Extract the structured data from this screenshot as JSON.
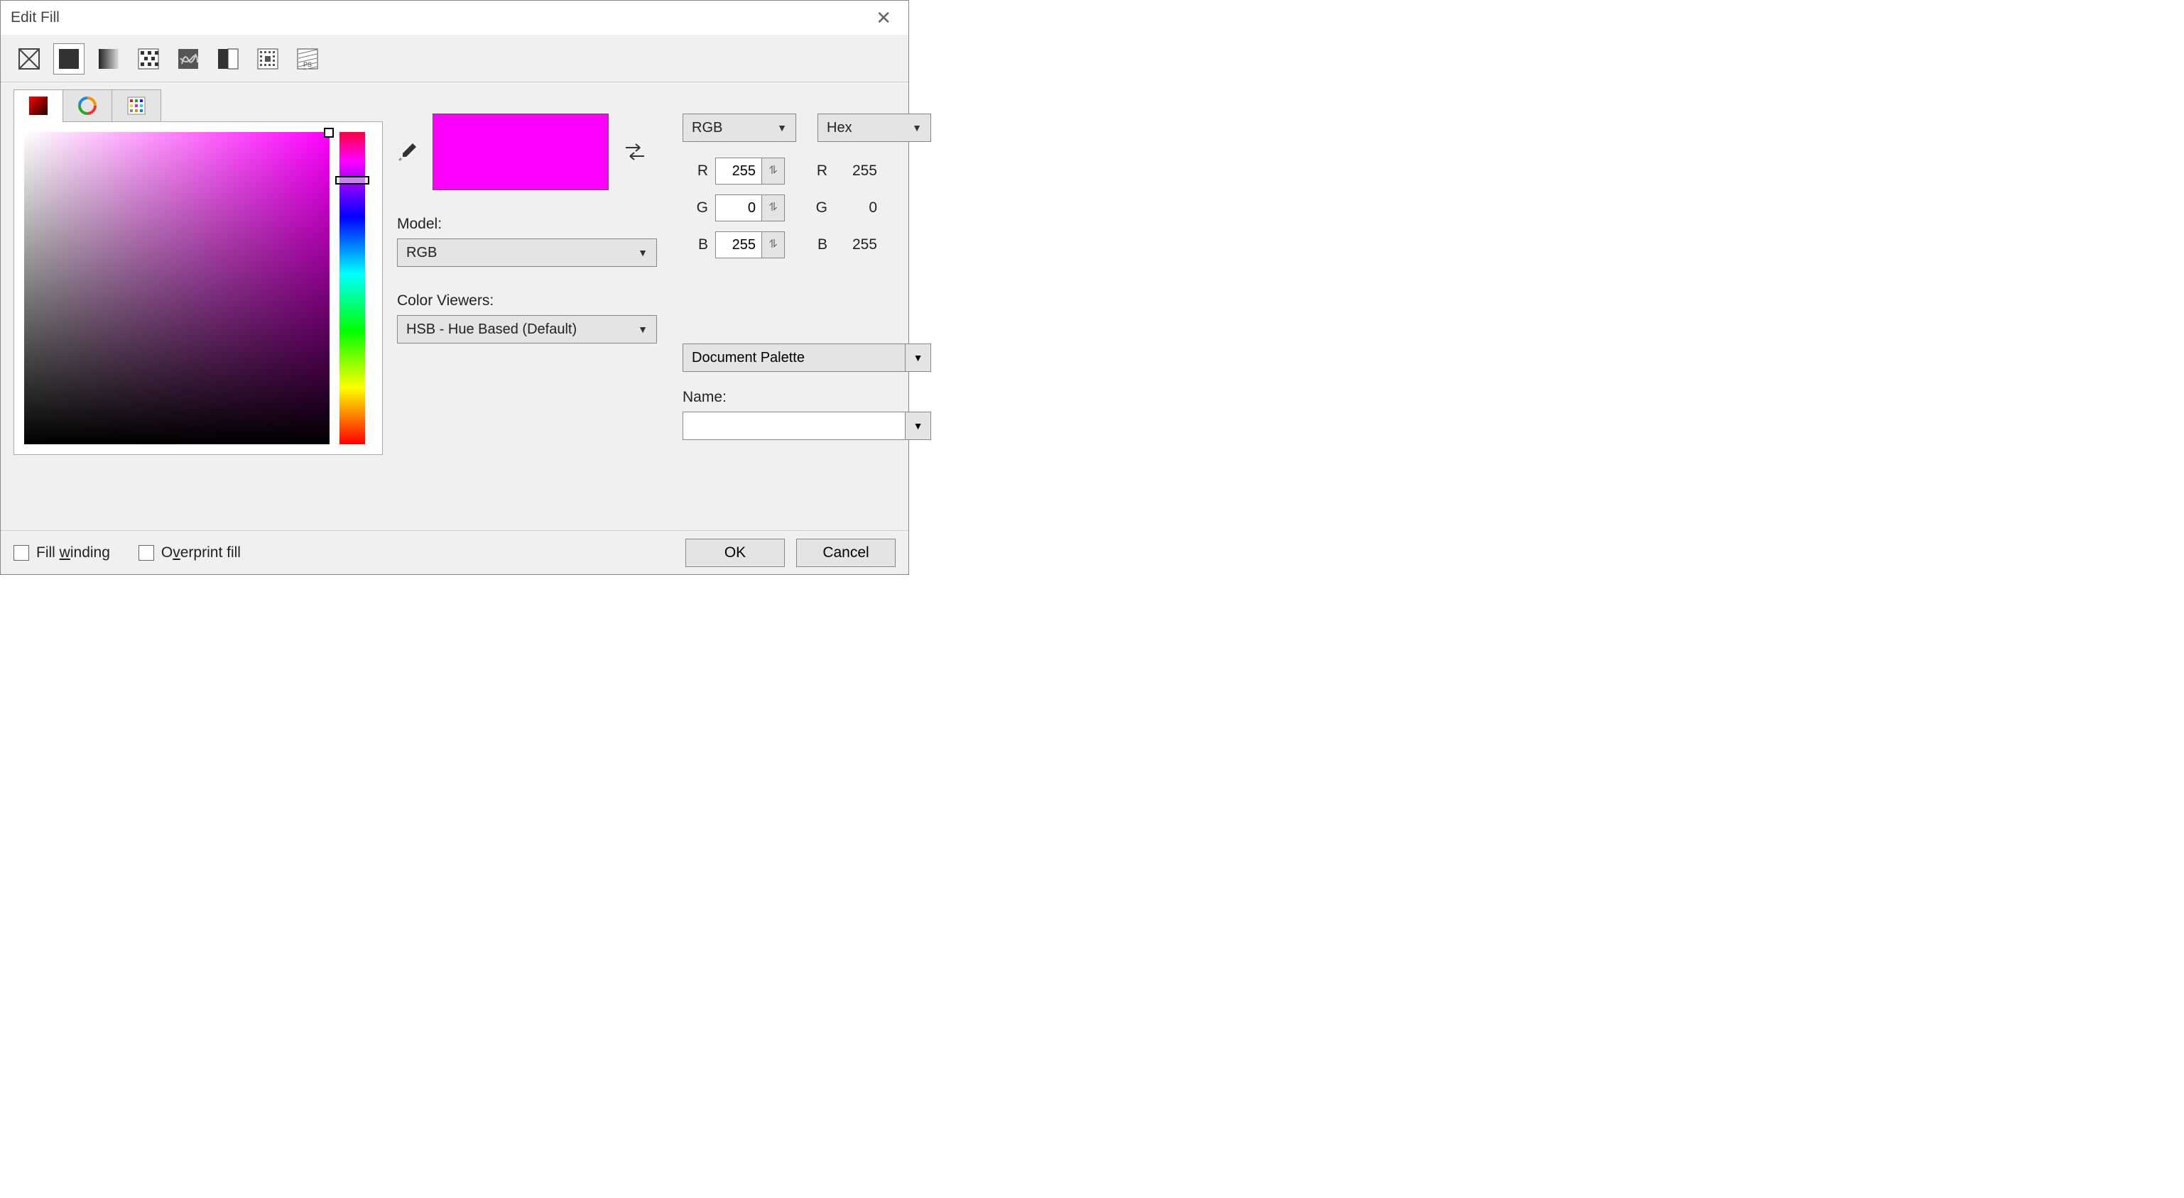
{
  "title": "Edit Fill",
  "toolbar_icons": [
    "none-fill",
    "solid-fill",
    "fountain-fill",
    "pattern-fill",
    "texture-fill",
    "two-color",
    "postscript",
    "hatch"
  ],
  "selected_tool": 1,
  "active_tab": 0,
  "current_color_hex": "#FF00FF",
  "model_label": "Model:",
  "model_value": "RGB",
  "viewers_label": "Color Viewers:",
  "viewers_value": "HSB - Hue Based (Default)",
  "left_dropdown": "RGB",
  "right_dropdown": "Hex",
  "channels": {
    "labels": [
      "R",
      "G",
      "B"
    ],
    "left_values": [
      255,
      0,
      255
    ],
    "right_values": [
      255,
      0,
      255
    ]
  },
  "palette_label_value": "Document Palette",
  "name_label": "Name:",
  "name_value": "",
  "fill_winding_label_pre": "Fill ",
  "fill_winding_label_u": "w",
  "fill_winding_label_post": "inding",
  "overprint_label_pre": "O",
  "overprint_label_u": "v",
  "overprint_label_post": "erprint fill",
  "ok_label": "OK",
  "cancel_label": "Cancel"
}
